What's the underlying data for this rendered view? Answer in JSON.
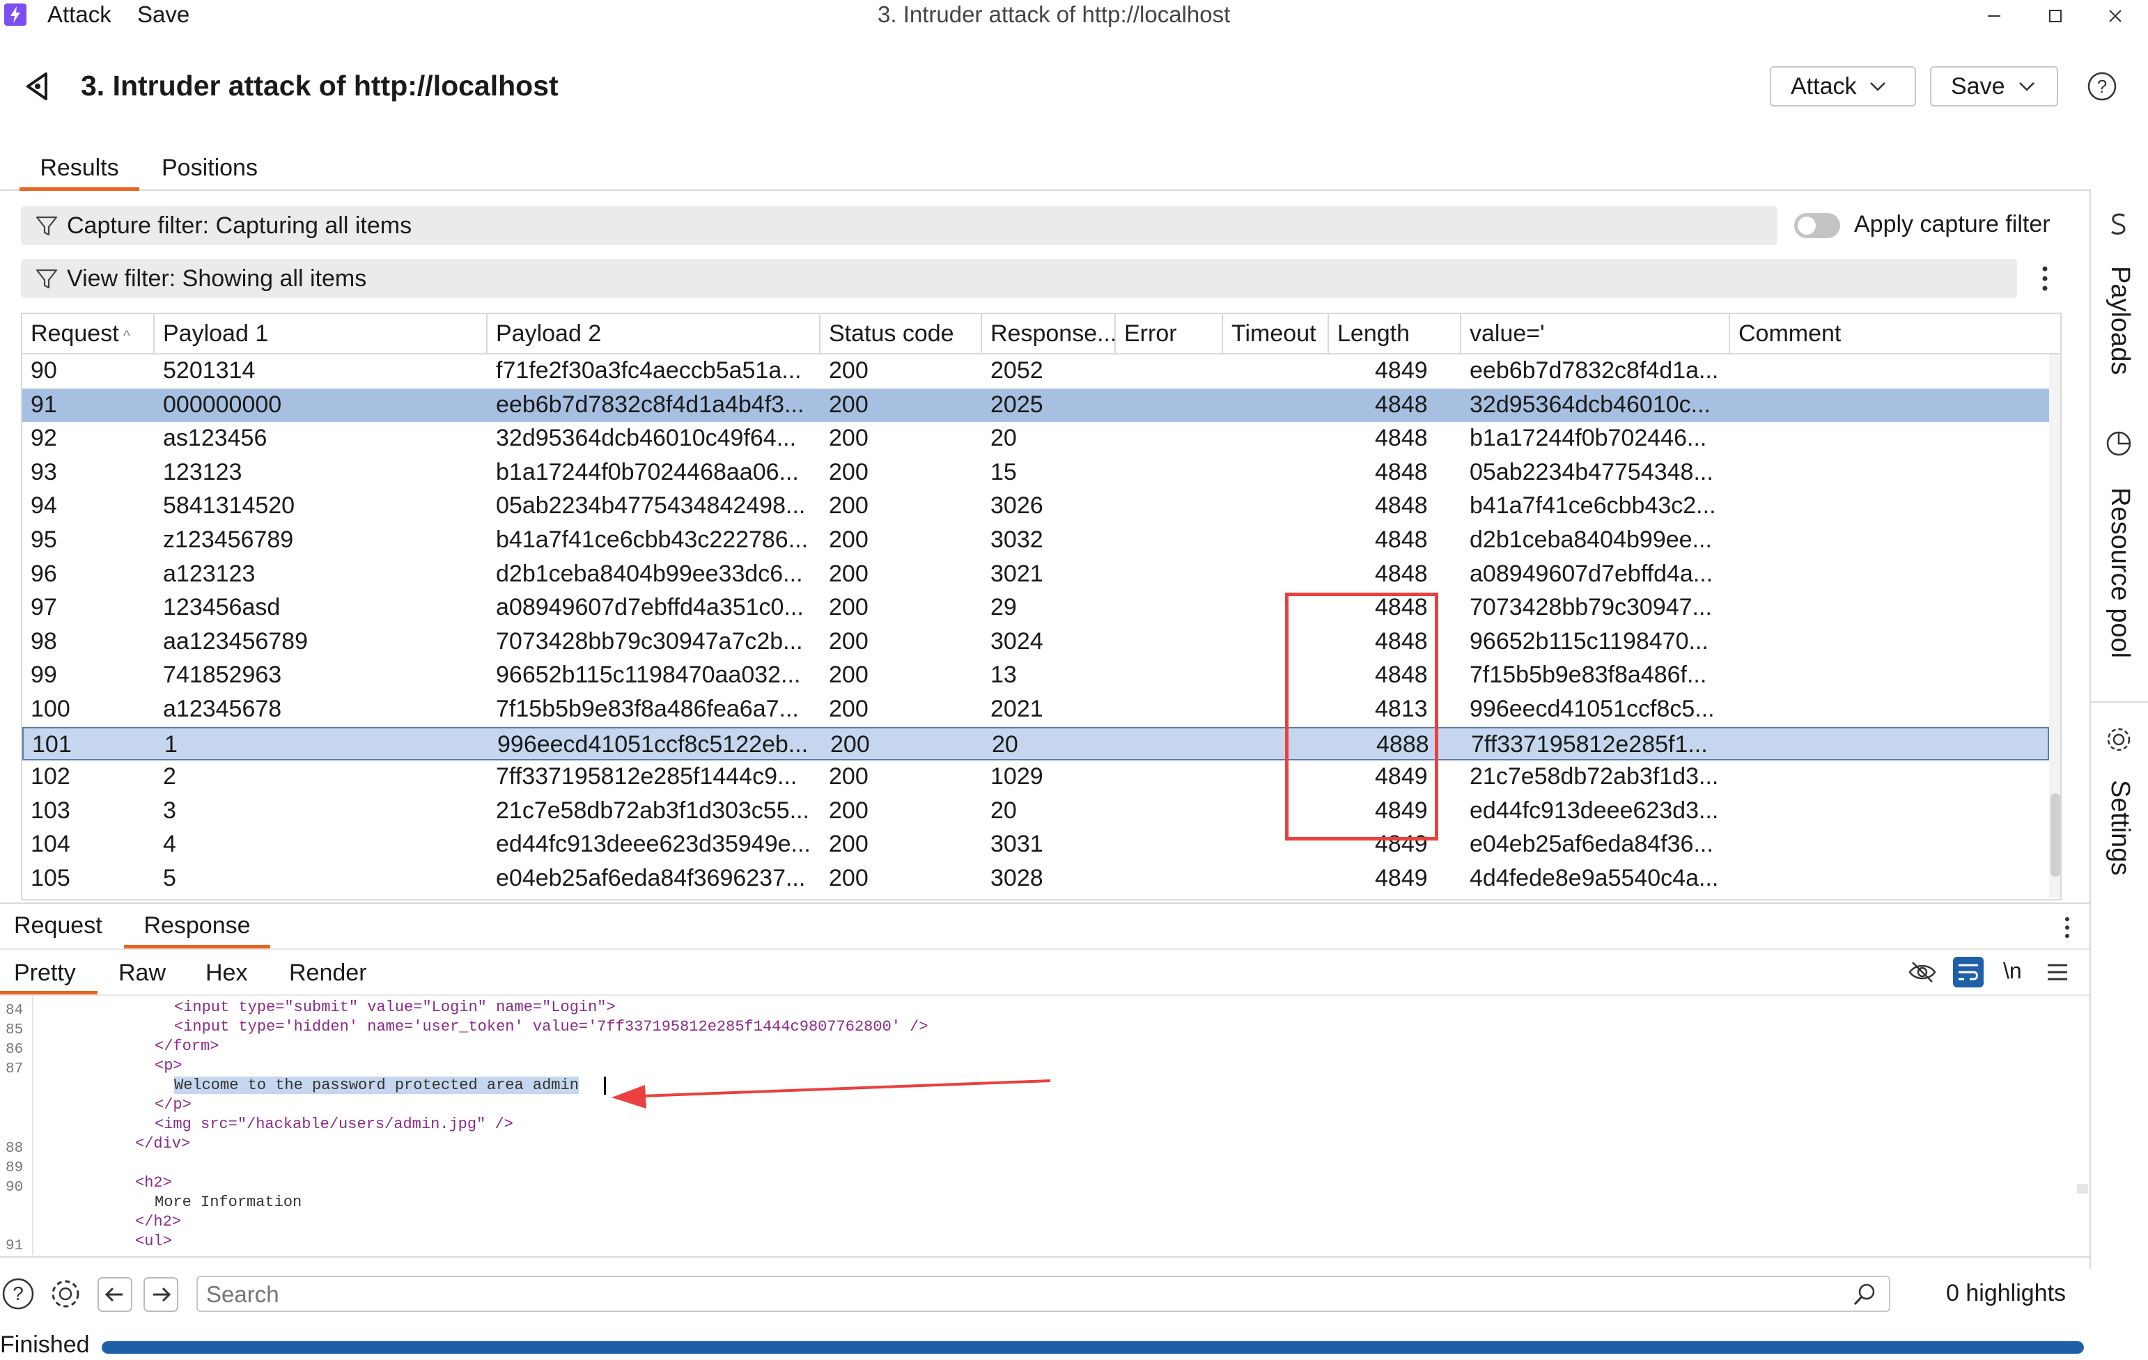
{
  "titlebar": {
    "menu": [
      "Attack",
      "Save"
    ],
    "window_title": "3. Intruder attack of http://localhost"
  },
  "header": {
    "title": "3. Intruder attack of http://localhost",
    "attack_label": "Attack",
    "save_label": "Save"
  },
  "tabs": [
    "Results",
    "Positions"
  ],
  "capture_filter": {
    "label": "Capture filter: Capturing all items",
    "toggle_label": "Apply capture filter"
  },
  "view_filter": {
    "label": "View filter: Showing all items"
  },
  "table": {
    "columns": [
      "Request",
      "Payload 1",
      "Payload 2",
      "Status code",
      "Response...",
      "Error",
      "Timeout",
      "Length",
      " value='",
      "Comment"
    ],
    "rows": [
      [
        "90",
        "5201314",
        "f71fe2f30a3fc4aeccb5a51a...",
        "200",
        "2052",
        "",
        "",
        "4849",
        "eeb6b7d7832c8f4d1a..."
      ],
      [
        "91",
        "000000000",
        "eeb6b7d7832c8f4d1a4b4f3...",
        "200",
        "2025",
        "",
        "",
        "4848",
        "32d95364dcb46010c..."
      ],
      [
        "92",
        "as123456",
        "32d95364dcb46010c49f64...",
        "200",
        "20",
        "",
        "",
        "4848",
        "b1a17244f0b702446..."
      ],
      [
        "93",
        "123123",
        "b1a17244f0b7024468aa06...",
        "200",
        "15",
        "",
        "",
        "4848",
        "05ab2234b47754348..."
      ],
      [
        "94",
        "5841314520",
        "05ab2234b4775434842498...",
        "200",
        "3026",
        "",
        "",
        "4848",
        "b41a7f41ce6cbb43c2..."
      ],
      [
        "95",
        "z123456789",
        "b41a7f41ce6cbb43c222786...",
        "200",
        "3032",
        "",
        "",
        "4848",
        "d2b1ceba8404b99ee..."
      ],
      [
        "96",
        "a123123",
        "d2b1ceba8404b99ee33dc6...",
        "200",
        "3021",
        "",
        "",
        "4848",
        "a08949607d7ebffd4a..."
      ],
      [
        "97",
        "123456asd",
        "a08949607d7ebffd4a351c0...",
        "200",
        "29",
        "",
        "",
        "4848",
        "7073428bb79c30947..."
      ],
      [
        "98",
        "aa123456789",
        "7073428bb79c30947a7c2b...",
        "200",
        "3024",
        "",
        "",
        "4848",
        "96652b115c1198470..."
      ],
      [
        "99",
        "741852963",
        "96652b115c1198470aa032...",
        "200",
        "13",
        "",
        "",
        "4848",
        "7f15b5b9e83f8a486f..."
      ],
      [
        "100",
        "a12345678",
        "7f15b5b9e83f8a486fea6a7...",
        "200",
        "2021",
        "",
        "",
        "4813",
        "996eecd41051ccf8c5..."
      ],
      [
        "101",
        "1",
        "996eecd41051ccf8c5122eb...",
        "200",
        "20",
        "",
        "",
        "4888",
        "7ff337195812e285f1..."
      ],
      [
        "102",
        "2",
        "7ff337195812e285f1444c9...",
        "200",
        "1029",
        "",
        "",
        "4849",
        "21c7e58db72ab3f1d3..."
      ],
      [
        "103",
        "3",
        "21c7e58db72ab3f1d303c55...",
        "200",
        "20",
        "",
        "",
        "4849",
        "ed44fc913deee623d3..."
      ],
      [
        "104",
        "4",
        "ed44fc913deee623d35949e...",
        "200",
        "3031",
        "",
        "",
        "4849",
        "e04eb25af6eda84f36..."
      ],
      [
        "105",
        "5",
        "e04eb25af6eda84f3696237...",
        "200",
        "3028",
        "",
        "",
        "4849",
        "4d4fede8e9a5540c4a..."
      ]
    ]
  },
  "lower_tabs": [
    "Request",
    "Response"
  ],
  "view_tabs": [
    "Pretty",
    "Raw",
    "Hex",
    "Render"
  ],
  "wrap_label": "\\n",
  "code": {
    "line_numbers": [
      "84",
      "85",
      "86",
      "87",
      "88",
      "89",
      "90",
      "91"
    ],
    "lines": [
      "<input type=\"submit\" value=\"Login\" name=\"Login\">",
      "<input type='hidden' name='user_token' value='7ff337195812e285f1444c9807762800' />",
      "</form>",
      "<p>",
      "Welcome to the password protected area admin",
      "</p>",
      "<img src=\"/hackable/users/admin.jpg\" />",
      "</div>",
      "<h2>",
      "More Information",
      "</h2>",
      "<ul>"
    ]
  },
  "search": {
    "placeholder": "Search",
    "highlights": "0 highlights"
  },
  "status": {
    "label": "Finished",
    "progress": 1.0
  },
  "sidebar": [
    "Payloads",
    "Resource pool",
    "Settings"
  ],
  "colors": {
    "accent": "#e8651f",
    "selection": "#a7c0e2",
    "progress": "#1f5fa8",
    "annotation": "#e8413f"
  }
}
